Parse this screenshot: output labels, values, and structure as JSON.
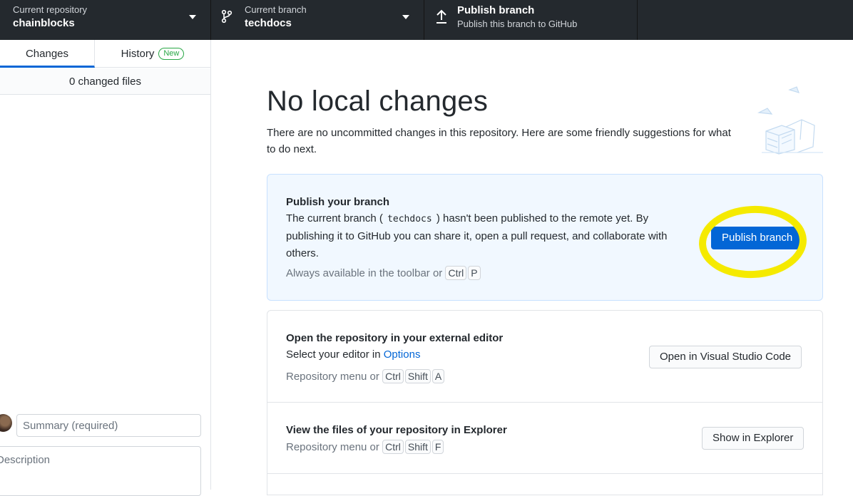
{
  "toolbar": {
    "repo": {
      "label": "Current repository",
      "value": "chainblocks"
    },
    "branch": {
      "label": "Current branch",
      "value": "techdocs"
    },
    "publish": {
      "title": "Publish branch",
      "subtitle": "Publish this branch to GitHub"
    }
  },
  "sidebar": {
    "tabs": [
      {
        "label": "Changes",
        "active": true
      },
      {
        "label": "History",
        "badge": "New"
      }
    ],
    "changed_files": "0 changed files",
    "summary_placeholder": "Summary (required)",
    "description_placeholder": "Description"
  },
  "main": {
    "title": "No local changes",
    "subtitle": "There are no uncommitted changes in this repository. Here are some friendly suggestions for what to do next.",
    "publish_card": {
      "title": "Publish your branch",
      "body_prefix": "The current branch (",
      "branch": "techdocs",
      "body_suffix": ") hasn't been published to the remote yet. By publishing it to GitHub you can share it, open a pull request, and collaborate with others.",
      "hint": "Always available in the toolbar or",
      "keys": [
        "Ctrl",
        "P"
      ],
      "button": "Publish branch"
    },
    "editor_card": {
      "title": "Open the repository in your external editor",
      "body_prefix": "Select your editor in",
      "link": "Options",
      "hint": "Repository menu or",
      "keys": [
        "Ctrl",
        "Shift",
        "A"
      ],
      "button": "Open in Visual Studio Code"
    },
    "explorer_card": {
      "title": "View the files of your repository in Explorer",
      "hint": "Repository menu or",
      "keys": [
        "Ctrl",
        "Shift",
        "F"
      ],
      "button": "Show in Explorer"
    }
  },
  "colors": {
    "toolbar_bg": "#24292e",
    "accent": "#0366d6",
    "highlight": "#f5ea00",
    "new_badge": "#28a745"
  }
}
